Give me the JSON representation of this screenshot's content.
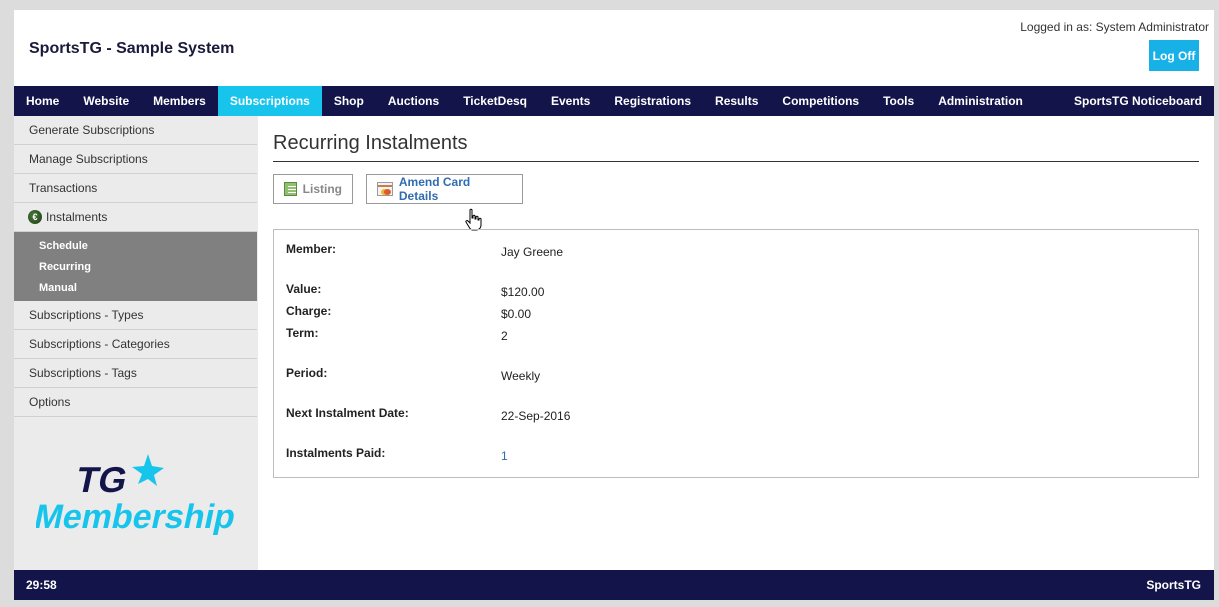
{
  "header": {
    "app_title": "SportsTG - Sample System",
    "logged_in": "Logged in as: System Administrator",
    "logoff_label": "Log Off"
  },
  "nav": {
    "items": [
      "Home",
      "Website",
      "Members",
      "Subscriptions",
      "Shop",
      "Auctions",
      "TicketDesq",
      "Events",
      "Registrations",
      "Results",
      "Competitions",
      "Tools",
      "Administration"
    ],
    "active": "Subscriptions",
    "right_item": "SportsTG Noticeboard"
  },
  "sidebar": {
    "items_top": [
      "Generate Subscriptions",
      "Manage Subscriptions",
      "Transactions"
    ],
    "instalments_label": "Instalments",
    "instalments_icon": "dollar-coin-icon",
    "sub_items": [
      "Schedule",
      "Recurring",
      "Manual"
    ],
    "items_bottom": [
      "Subscriptions - Types",
      "Subscriptions - Categories",
      "Subscriptions - Tags",
      "Options"
    ],
    "logo": {
      "line1": "TG",
      "line2": "Membership"
    }
  },
  "main": {
    "title": "Recurring Instalments",
    "buttons": {
      "listing": "Listing",
      "amend": "Amend Card Details"
    },
    "details": {
      "member_label": "Member:",
      "member_value": "Jay Greene",
      "value_label": "Value:",
      "value_value": "$120.00",
      "charge_label": "Charge:",
      "charge_value": "$0.00",
      "term_label": "Term:",
      "term_value": "2",
      "period_label": "Period:",
      "period_value": "Weekly",
      "next_label": "Next Instalment Date:",
      "next_value": "22-Sep-2016",
      "paid_label": "Instalments Paid:",
      "paid_value": "1"
    }
  },
  "footer": {
    "timer": "29:58",
    "brand": "SportsTG"
  },
  "colors": {
    "nav_bg": "#13144a",
    "accent": "#17c4ec",
    "logoff": "#17b1e8",
    "logo_cyan": "#17c4ec",
    "logo_navy": "#13144a"
  }
}
